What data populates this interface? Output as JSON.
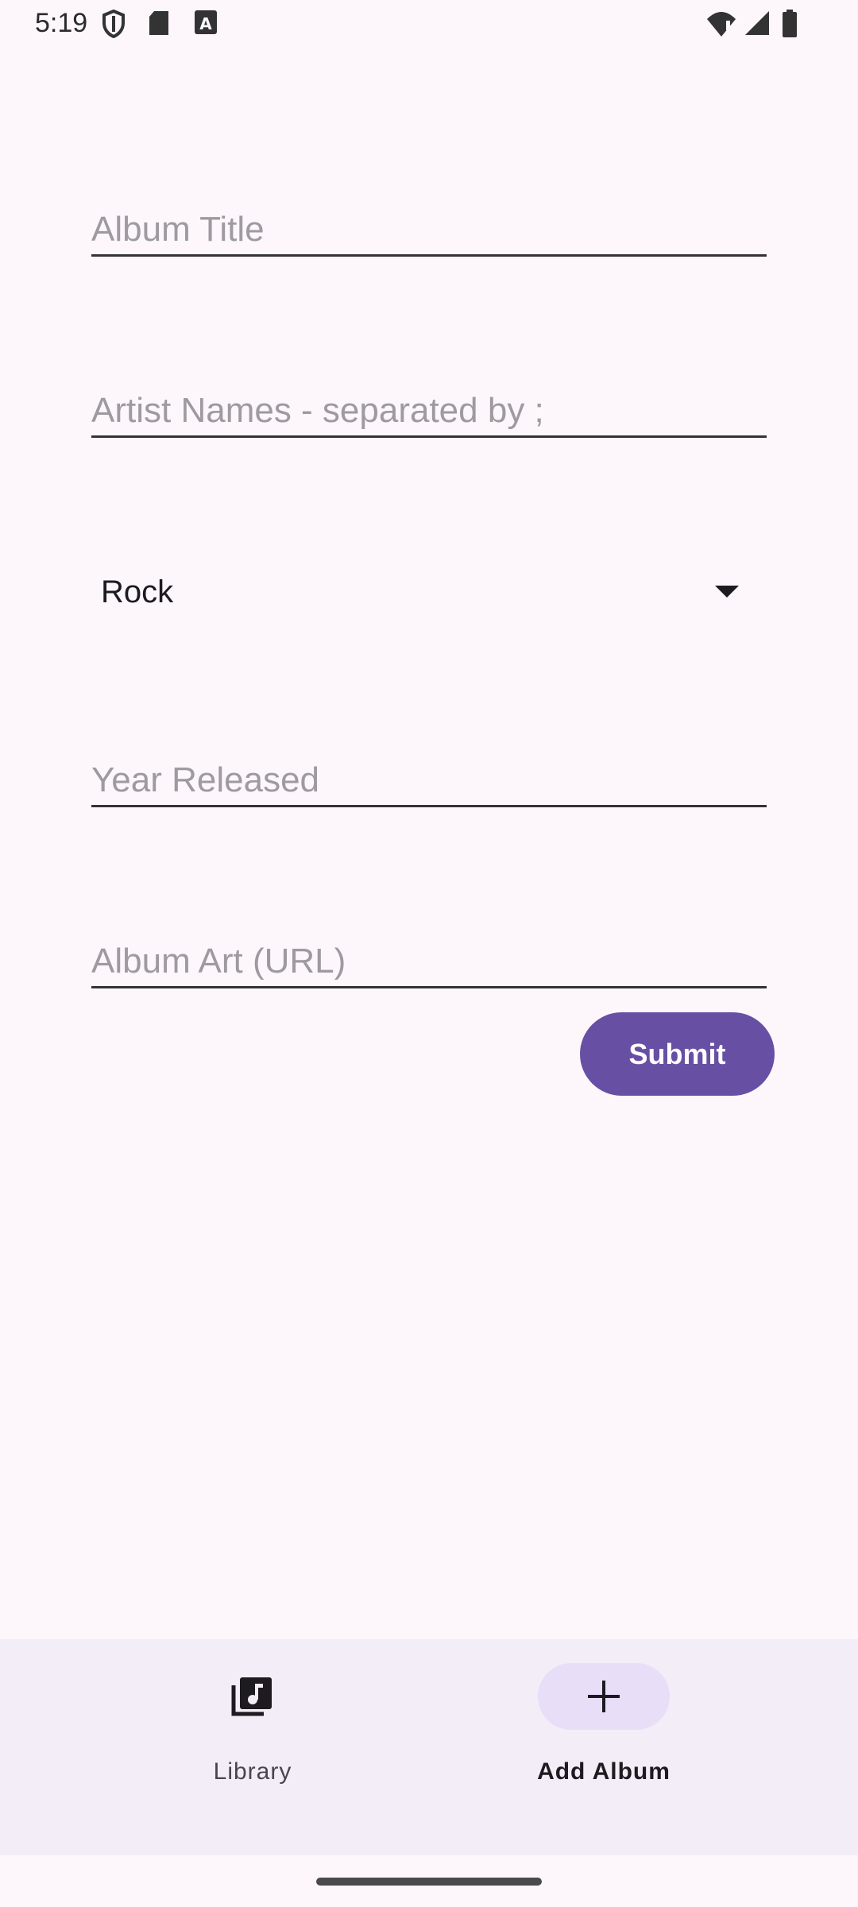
{
  "status_bar": {
    "time": "5:19",
    "icons": [
      "shield-icon",
      "sd-card-icon",
      "a-notification-icon",
      "wifi-alert-icon",
      "signal-icon",
      "battery-icon"
    ]
  },
  "form": {
    "album_title": {
      "placeholder": "Album Title",
      "value": ""
    },
    "artist_names": {
      "placeholder": "Artist Names - separated by ;",
      "value": ""
    },
    "genre": {
      "selected": "Rock"
    },
    "year_released": {
      "placeholder": "Year Released",
      "value": ""
    },
    "album_art": {
      "placeholder": "Album Art (URL)",
      "value": ""
    },
    "submit_label": "Submit"
  },
  "bottom_nav": {
    "items": [
      {
        "label": "Library",
        "icon": "library-music-icon",
        "selected": false
      },
      {
        "label": "Add Album",
        "icon": "plus-icon",
        "selected": true
      }
    ]
  },
  "colors": {
    "background": "#FDF7FC",
    "primary": "#6750A4",
    "nav_background": "#F3EDF7",
    "nav_indicator": "#E8DEF8"
  }
}
